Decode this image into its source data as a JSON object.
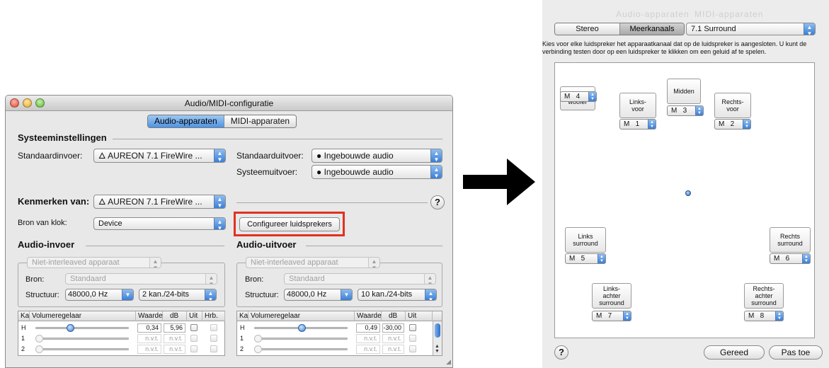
{
  "window": {
    "title": "Audio/MIDI-configuratie",
    "tabs": [
      {
        "label": "Audio-apparaten",
        "selected": true
      },
      {
        "label": "MIDI-apparaten",
        "selected": false
      }
    ],
    "system_settings": {
      "heading": "Systeeminstellingen",
      "default_input_label": "Standaardinvoer:",
      "default_input_value": "AUREON 7.1 FireWire ...",
      "default_output_label": "Standaarduitvoer:",
      "default_output_value": "Ingebouwde audio",
      "system_output_label": "Systeemuitvoer:",
      "system_output_value": "Ingebouwde audio"
    },
    "properties": {
      "label": "Kenmerken van:",
      "device": "AUREON 7.1 FireWire ...",
      "help": "?"
    },
    "clock": {
      "label": "Bron van klok:",
      "value": "Device",
      "configure_button": "Configureer luidsprekers"
    },
    "audio_input": {
      "heading": "Audio-invoer",
      "format": "Niet-interleaved apparaat",
      "source_label": "Bron:",
      "source_value": "Standaard",
      "structure_label": "Structuur:",
      "rate": "48000,0 Hz",
      "channels": "2 kan./24-bits",
      "table": {
        "headers": [
          "Ka",
          "Volumeregelaar",
          "Waarde",
          "dB",
          "Uit",
          "Hrb."
        ],
        "rows": [
          {
            "ch": "H",
            "level": 0.35,
            "value": "0,34",
            "db": "5,96",
            "enabled": true
          },
          {
            "ch": "1",
            "level": 0.0,
            "value": "n.v.t.",
            "db": "n.v.t.",
            "enabled": false
          },
          {
            "ch": "2",
            "level": 0.0,
            "value": "n.v.t.",
            "db": "n.v.t.",
            "enabled": false
          }
        ]
      }
    },
    "audio_output": {
      "heading": "Audio-uitvoer",
      "format": "Niet-interleaved apparaat",
      "source_label": "Bron:",
      "source_value": "Standaard",
      "structure_label": "Structuur:",
      "rate": "48000,0 Hz",
      "channels": "10 kan./24-bits",
      "table": {
        "headers": [
          "Ka",
          "Volumeregelaar",
          "Waarde",
          "dB",
          "Uit"
        ],
        "rows": [
          {
            "ch": "H",
            "level": 0.49,
            "value": "0,49",
            "db": "-30,00",
            "enabled": true
          },
          {
            "ch": "1",
            "level": 0.0,
            "value": "n.v.t.",
            "db": "n.v.t.",
            "enabled": false
          },
          {
            "ch": "2",
            "level": 0.0,
            "value": "n.v.t.",
            "db": "n.v.t.",
            "enabled": false
          }
        ]
      }
    }
  },
  "speaker_panel": {
    "faded_tabs": [
      "Audio-apparaten",
      "MIDI-apparaten"
    ],
    "mode_tabs": [
      {
        "label": "Stereo",
        "selected": false
      },
      {
        "label": "Meerkanaals",
        "selected": true
      }
    ],
    "surround_format": "7.1 Surround",
    "instructions": "Kies voor elke luidspreker het apparaatkanaal dat op de luidspreker is aangesloten. U kunt de verbinding testen door op een luidspreker te klikken om een geluid af te spelen.",
    "speakers": [
      {
        "name": "Sub-\nwoofer",
        "channel": "M   4"
      },
      {
        "name": "Midden",
        "channel": "M   3"
      },
      {
        "name": "Links-\nvoor",
        "channel": "M   1"
      },
      {
        "name": "Rechts-\nvoor",
        "channel": "M   2"
      },
      {
        "name": "Links\nsurround",
        "channel": "M   5"
      },
      {
        "name": "Rechts\nsurround",
        "channel": "M   6"
      },
      {
        "name": "Links-\nachter\nsurround",
        "channel": "M   7"
      },
      {
        "name": "Rechts-\nachter\nsurround",
        "channel": "M   8"
      }
    ],
    "help": "?",
    "done_button": "Gereed",
    "apply_button": "Pas toe"
  }
}
